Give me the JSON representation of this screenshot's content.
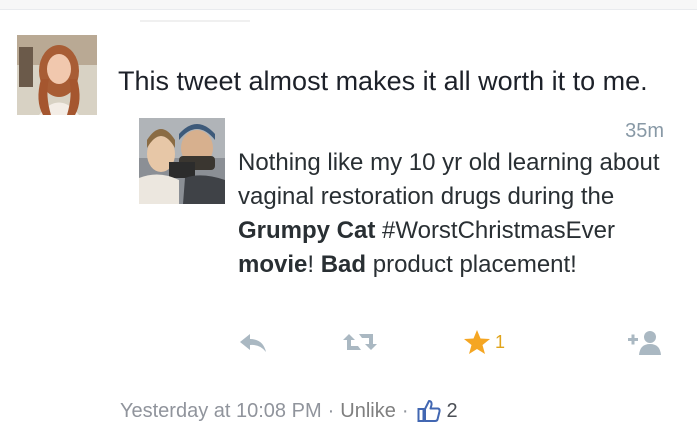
{
  "post": {
    "text": "This tweet almost makes it all worth it to me."
  },
  "tweet": {
    "time": "35m",
    "body": {
      "part1": "Nothing like my 10 yr old learning about vaginal restoration drugs during the ",
      "bold1": "Grumpy Cat",
      "part2": " #WorstChristmasEver ",
      "bold2": "movie",
      "part3": "!  ",
      "bold3": "Bad",
      "part4": " product placement!"
    },
    "favorite_count": "1",
    "icons": [
      "reply-icon",
      "retweet-icon",
      "star-icon",
      "follow-icon"
    ],
    "colors": {
      "star": "#f5a623",
      "muted": "#aab8c2"
    }
  },
  "footer": {
    "timestamp": "Yesterday at 10:08 PM",
    "separator": "·",
    "unlike_label": "Unlike",
    "like_count": "2",
    "icon": "thumbs-up-icon",
    "colors": {
      "thumb": "#4267b2"
    }
  }
}
